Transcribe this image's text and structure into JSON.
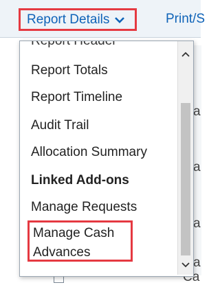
{
  "toolbar": {
    "report_details_label": "Report Details",
    "print_label": "Print/S"
  },
  "background": {
    "right_fragments": [
      "a",
      "a",
      "a",
      "a"
    ],
    "bottom_fragment": "Ca"
  },
  "menu": {
    "partial_top_label": "Report Header",
    "items": [
      {
        "label": "Report Totals"
      },
      {
        "label": "Report Timeline"
      },
      {
        "label": "Audit Trail"
      },
      {
        "label": "Allocation Summary"
      },
      {
        "label": "Linked Add-ons"
      },
      {
        "label": "Manage Requests"
      }
    ],
    "highlighted_item": {
      "line1": "Manage Cash",
      "line2": "Advances"
    }
  },
  "colors": {
    "link_blue": "#0f63b8",
    "highlight_red": "#e53941"
  },
  "icons": {
    "dropdown": "chevron-down-icon",
    "scroll_up": "scroll-up-icon",
    "scroll_down": "scroll-down-icon"
  }
}
